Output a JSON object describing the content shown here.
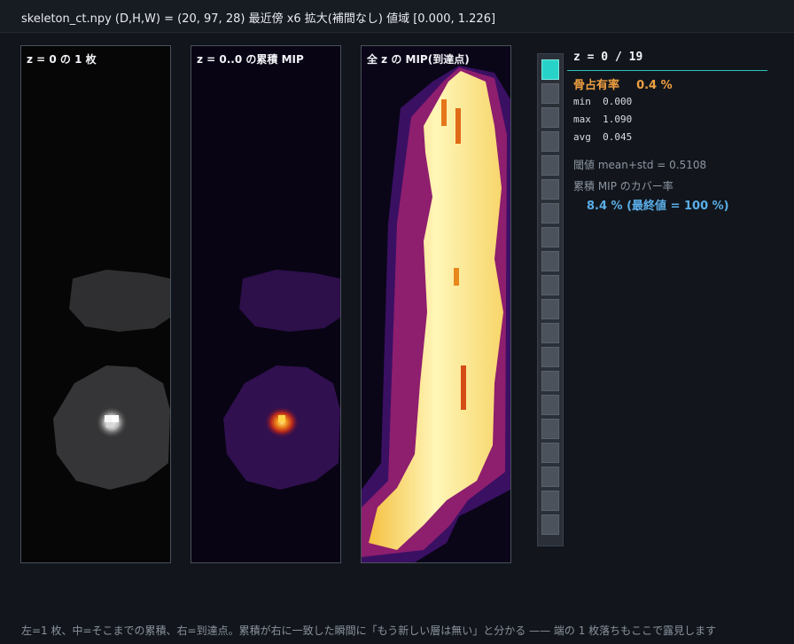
{
  "header": {
    "title": "skeleton_ct.npy  (D,H,W) = (20, 97, 28)   最近傍 x6 拡大(補間なし)   値域 [0.000, 1.226]"
  },
  "panels": [
    {
      "label": "z =  0 の 1 枚"
    },
    {
      "label": "z = 0..0 の累積 MIP"
    },
    {
      "label": "全 z の MIP(到達点)"
    }
  ],
  "slider": {
    "count": 20,
    "active_index": 0
  },
  "info": {
    "z_line": "z =  0 / 19",
    "bone_label": "骨占有率",
    "bone_value": "0.4 %",
    "min_label": "min",
    "min_value": "0.000",
    "max_label": "max",
    "max_value": "1.090",
    "avg_label": "avg",
    "avg_value": "0.045",
    "threshold": "閾値 mean+std = 0.5108",
    "coverage_label": "累積 MIP のカバー率",
    "coverage_value": "8.4 % (最終値 = 100 %)"
  },
  "colors": {
    "accent": "#27d3c9",
    "bone": "#f0a040",
    "coverage": "#5aaee8"
  },
  "footer": {
    "text": "左=1 枚、中=そこまでの累積、右=到達点。累積が右に一致した瞬間に「もう新しい層は無い」と分かる —— 端の 1 枚落ちもここで露見します"
  }
}
